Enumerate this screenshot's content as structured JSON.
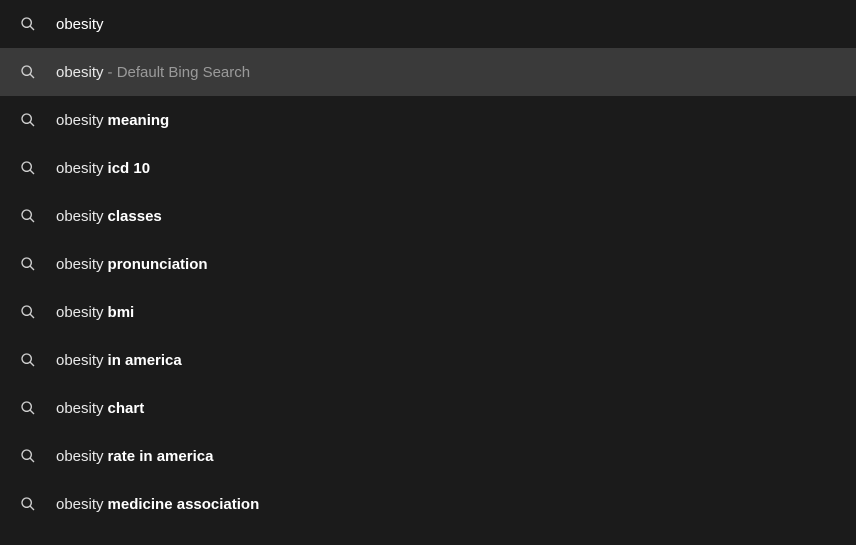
{
  "search": {
    "query": "obesity"
  },
  "suggestions": [
    {
      "prefix": "obesity",
      "bold": "",
      "tail": "- Default Bing Search",
      "highlight": true
    },
    {
      "prefix": "obesity",
      "bold": "meaning",
      "tail": "",
      "highlight": false
    },
    {
      "prefix": "obesity",
      "bold": "icd 10",
      "tail": "",
      "highlight": false
    },
    {
      "prefix": "obesity",
      "bold": "classes",
      "tail": "",
      "highlight": false
    },
    {
      "prefix": "obesity",
      "bold": "pronunciation",
      "tail": "",
      "highlight": false
    },
    {
      "prefix": "obesity",
      "bold": "bmi",
      "tail": "",
      "highlight": false
    },
    {
      "prefix": "obesity",
      "bold": "in america",
      "tail": "",
      "highlight": false
    },
    {
      "prefix": "obesity",
      "bold": "chart",
      "tail": "",
      "highlight": false
    },
    {
      "prefix": "obesity",
      "bold": "rate in america",
      "tail": "",
      "highlight": false
    },
    {
      "prefix": "obesity",
      "bold": "medicine association",
      "tail": "",
      "highlight": false
    }
  ]
}
